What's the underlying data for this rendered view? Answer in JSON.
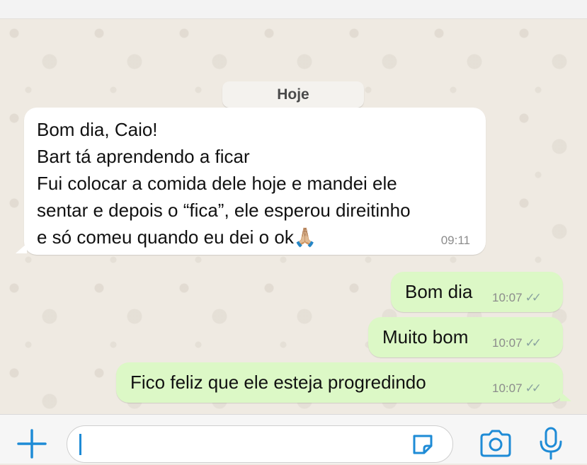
{
  "date_label": "Hoje",
  "messages": [
    {
      "direction": "incoming",
      "lines": [
        "Bom dia, Caio!",
        "Bart tá aprendendo a ficar",
        "Fui colocar a comida dele hoje e mandei ele",
        "sentar e depois o “fica”, ele esperou direitinho",
        "e só comeu quando eu dei o ok🙏🏼"
      ],
      "time": "09:11"
    },
    {
      "direction": "outgoing",
      "text": "Bom dia",
      "time": "10:07",
      "status": "read-ticks"
    },
    {
      "direction": "outgoing",
      "text": "Muito bom",
      "time": "10:07",
      "status": "read-ticks"
    },
    {
      "direction": "outgoing",
      "text": "Fico feliz que ele esteja progredindo",
      "time": "10:07",
      "status": "read-ticks"
    }
  ],
  "composer": {
    "icons": [
      "plus-icon",
      "sticker-icon",
      "camera-icon",
      "microphone-icon"
    ],
    "input_value": "",
    "accent_color": "#1e8bd6"
  },
  "colors": {
    "incoming_bubble": "#ffffff",
    "outgoing_bubble": "#dcf8c6",
    "wallpaper": "#efeae2"
  }
}
